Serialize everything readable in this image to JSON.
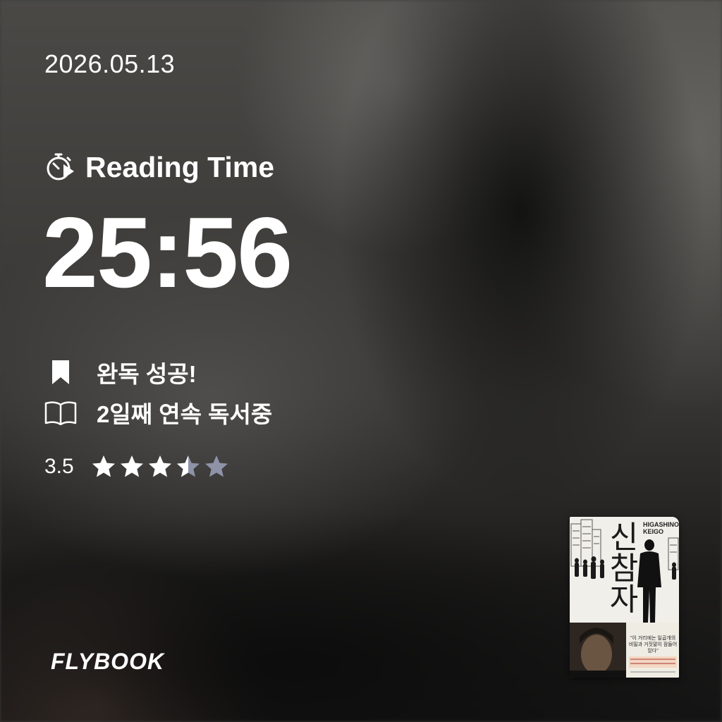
{
  "date": "2026.05.13",
  "reading_time": {
    "icon": "stopwatch-play-icon",
    "label": "Reading Time",
    "value": "25:56"
  },
  "status": [
    {
      "icon": "bookmark-icon",
      "text": "완독 성공!"
    },
    {
      "icon": "open-book-icon",
      "text": "2일째 연속 독서중"
    }
  ],
  "rating": {
    "value_text": "3.5",
    "value": 3.5,
    "max": 5,
    "filled_color": "#ffffff",
    "empty_color": "#8e93a8"
  },
  "brand": {
    "logo": "FLYBOOK"
  },
  "book_cover": {
    "title": "신참자",
    "author_line1": "HIGASHINO",
    "author_line2": "KEIGO",
    "quote": "\"이 거리에는 일곱개의 비밀과 거짓말이 잠들어 있다\""
  },
  "colors": {
    "text": "#ffffff",
    "background": "#3d3c3a"
  }
}
